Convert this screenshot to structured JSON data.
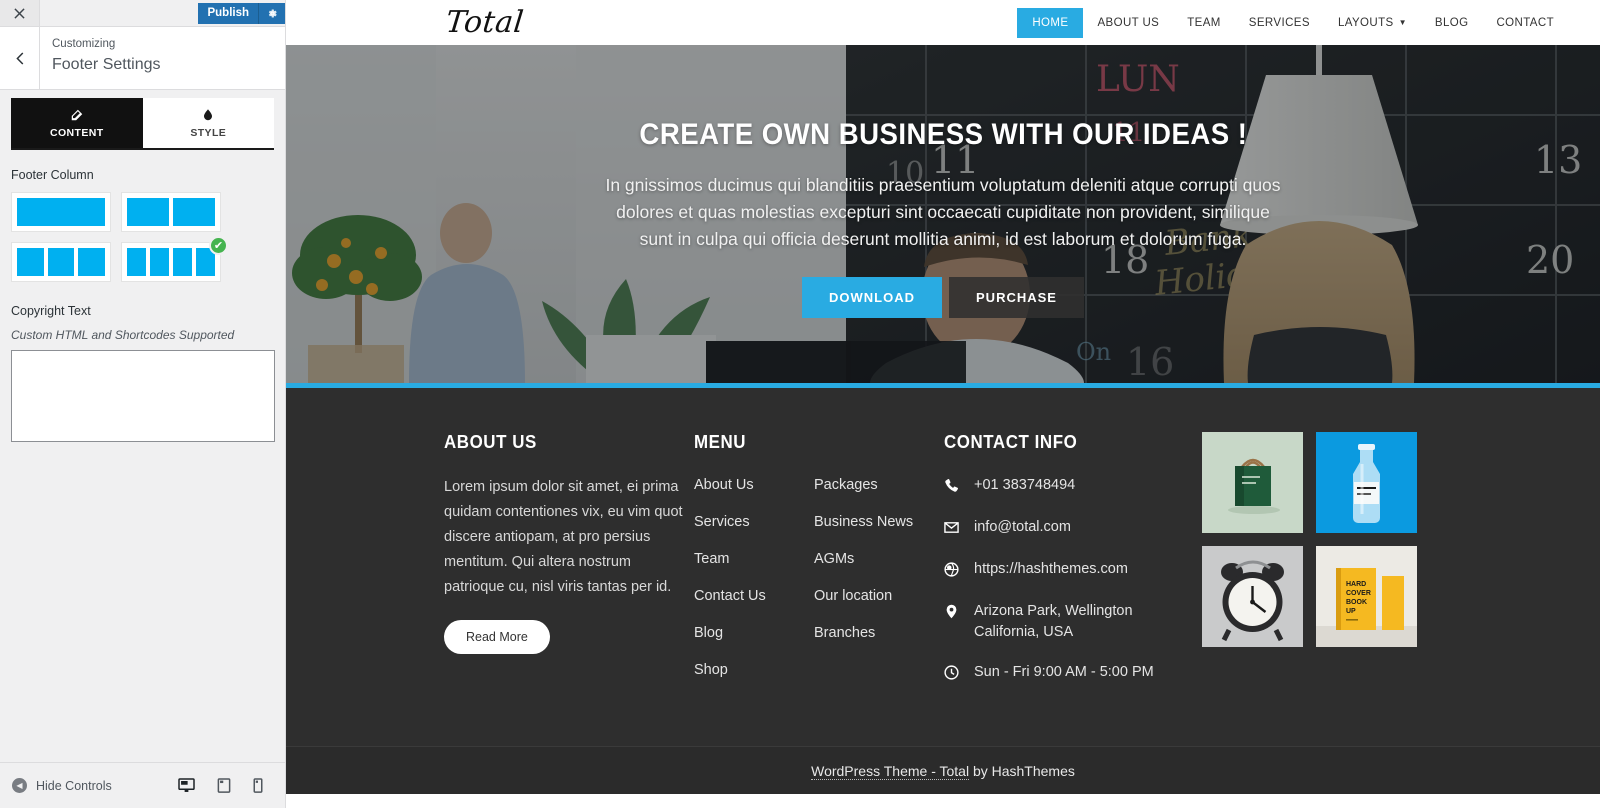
{
  "customizer": {
    "close_label": "×",
    "publish_label": "Publish",
    "gear_icon": "gear-icon",
    "back_icon": "chevron-left-icon",
    "breadcrumb": "Customizing",
    "panel_title": "Footer Settings",
    "tabs": [
      {
        "label": "CONTENT",
        "icon": "edit-pencil-icon",
        "active": true
      },
      {
        "label": "STYLE",
        "icon": "paint-drop-icon",
        "active": false
      }
    ],
    "footer_column": {
      "label": "Footer Column",
      "options": [
        {
          "name": "one-column",
          "segments": 1,
          "selected": false
        },
        {
          "name": "two-column",
          "segments": 2,
          "selected": false
        },
        {
          "name": "three-column",
          "segments": 3,
          "selected": false
        },
        {
          "name": "four-column",
          "segments": 4,
          "selected": true
        }
      ],
      "check_glyph": "✔"
    },
    "copyright": {
      "label": "Copyright Text",
      "help": "Custom HTML and Shortcodes Supported",
      "value": "",
      "placeholder": ""
    },
    "bottom": {
      "hide_controls_label": "Hide Controls",
      "devices": [
        {
          "name": "desktop-preview",
          "active": true
        },
        {
          "name": "tablet-preview",
          "active": false
        },
        {
          "name": "mobile-preview",
          "active": false
        }
      ]
    }
  },
  "site": {
    "logo": "Total",
    "nav": [
      {
        "label": "HOME",
        "active": true,
        "has_dropdown": false
      },
      {
        "label": "ABOUT US",
        "active": false,
        "has_dropdown": false
      },
      {
        "label": "TEAM",
        "active": false,
        "has_dropdown": false
      },
      {
        "label": "SERVICES",
        "active": false,
        "has_dropdown": false
      },
      {
        "label": "LAYOUTS",
        "active": false,
        "has_dropdown": true
      },
      {
        "label": "BLOG",
        "active": false,
        "has_dropdown": false
      },
      {
        "label": "CONTACT",
        "active": false,
        "has_dropdown": false
      }
    ],
    "hero": {
      "title": "CREATE OWN BUSINESS WITH OUR IDEAS !",
      "text": "In gnissimos ducimus qui blanditiis praesentium voluptatum deleniti atque corrupti quos dolores et quas molestias excepturi sint occaecati cupiditate non provident, similique sunt in culpa qui officia deserunt mollitia animi, id est laborum et dolorum fuga.",
      "primary_button": "DOWNLOAD",
      "secondary_button": "PURCHASE"
    },
    "footer": {
      "about": {
        "heading": "ABOUT US",
        "text": "Lorem ipsum dolor sit amet, ei prima quidam contentiones vix, eu vim quot discere antiopam, at pro persius mentitum. Qui altera nostrum patrioque cu, nisl viris tantas per id.",
        "button": "Read More"
      },
      "menu": {
        "heading": "MENU",
        "column_one": [
          "About Us",
          "Services",
          "Team",
          "Contact Us",
          "Blog",
          "Shop"
        ],
        "column_two": [
          "Packages",
          "Business News",
          "AGMs",
          "Our location",
          "Branches"
        ]
      },
      "contact": {
        "heading": "CONTACT INFO",
        "items": [
          {
            "icon": "phone-icon",
            "text": "+01 383748494"
          },
          {
            "icon": "envelope-icon",
            "text": "info@total.com"
          },
          {
            "icon": "globe-icon",
            "text": "https://hashthemes.com"
          },
          {
            "icon": "map-pin-icon",
            "text": "Arizona Park, Wellington California, USA"
          },
          {
            "icon": "clock-icon",
            "text": "Sun - Fri 9:00 AM - 5:00 PM"
          }
        ]
      },
      "gallery": [
        {
          "name": "paper-bag-thumbnail"
        },
        {
          "name": "glass-bottle-thumbnail"
        },
        {
          "name": "alarm-clock-thumbnail"
        },
        {
          "name": "hardcover-book-thumbnail"
        }
      ],
      "bottom": {
        "link_text": "WordPress Theme - Total",
        "suffix_text": " by HashThemes"
      }
    }
  },
  "colors": {
    "accent_blue": "#29abe2",
    "wp_blue": "#2271b1",
    "footer_bg": "#2e2e2e",
    "option_blue": "#00b0f0",
    "check_green": "#46b450"
  }
}
